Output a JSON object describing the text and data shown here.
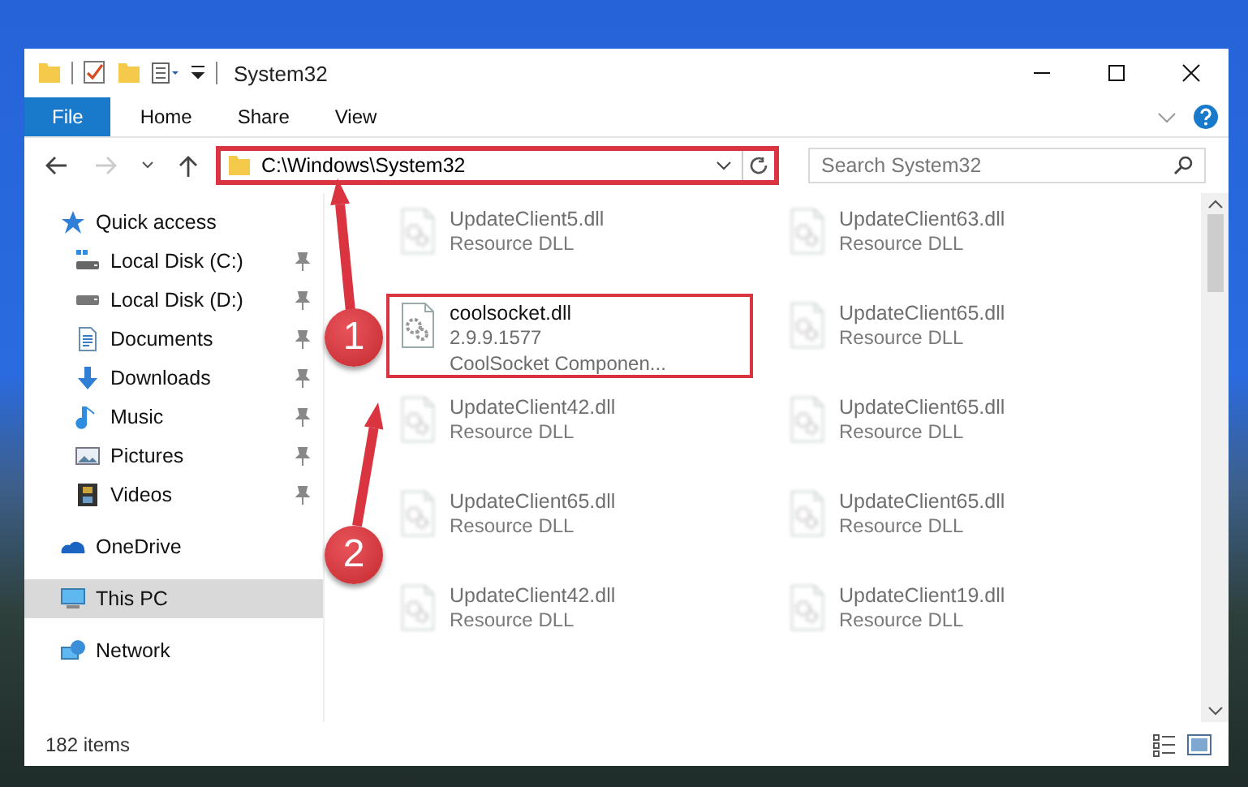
{
  "window": {
    "title": "System32"
  },
  "ribbon_tabs": [
    {
      "label": "File",
      "kind": "file"
    },
    {
      "label": "Home",
      "kind": "tab"
    },
    {
      "label": "Share",
      "kind": "tab"
    },
    {
      "label": "View",
      "kind": "tab"
    }
  ],
  "address_bar": {
    "path": "C:\\Windows\\System32",
    "highlighted": true
  },
  "search": {
    "placeholder": "Search System32"
  },
  "sidebar": {
    "items": [
      {
        "label": "Quick access",
        "kind": "star",
        "selected": false,
        "children": [
          {
            "label": "Local Disk (C:)",
            "kind": "system-drive",
            "pinned": true,
            "selected": false
          },
          {
            "label": "Local Disk (D:)",
            "kind": "drive",
            "pinned": true,
            "selected": false
          },
          {
            "label": "Documents",
            "kind": "documents",
            "pinned": true,
            "selected": false
          },
          {
            "label": "Downloads",
            "kind": "downloads",
            "pinned": true,
            "selected": false
          },
          {
            "label": "Music",
            "kind": "music",
            "pinned": true,
            "selected": false
          },
          {
            "label": "Pictures",
            "kind": "pictures",
            "pinned": true,
            "selected": false
          },
          {
            "label": "Videos",
            "kind": "videos",
            "pinned": true,
            "selected": false
          }
        ]
      },
      {
        "label": "OneDrive",
        "kind": "cloud",
        "selected": false
      },
      {
        "label": "This PC",
        "kind": "pc",
        "selected": true
      },
      {
        "label": "Network",
        "kind": "network",
        "selected": false
      }
    ]
  },
  "files": [
    {
      "name": "UpdateClient5.dll",
      "details": [
        "Resource DLL"
      ],
      "blurred": true,
      "highlighted": false
    },
    {
      "name": "UpdateClient63.dll",
      "details": [
        "Resource DLL"
      ],
      "blurred": true,
      "highlighted": false
    },
    {
      "name": "coolsocket.dll",
      "details": [
        "2.9.9.1577",
        "CoolSocket Componen..."
      ],
      "blurred": false,
      "highlighted": true
    },
    {
      "name": "UpdateClient65.dll",
      "details": [
        "Resource DLL"
      ],
      "blurred": true,
      "highlighted": false
    },
    {
      "name": "UpdateClient42.dll",
      "details": [
        "Resource DLL"
      ],
      "blurred": true,
      "highlighted": false
    },
    {
      "name": "UpdateClient65.dll",
      "details": [
        "Resource DLL"
      ],
      "blurred": true,
      "highlighted": false
    },
    {
      "name": "UpdateClient65.dll",
      "details": [
        "Resource DLL"
      ],
      "blurred": true,
      "highlighted": false
    },
    {
      "name": "UpdateClient65.dll",
      "details": [
        "Resource DLL"
      ],
      "blurred": true,
      "highlighted": false
    },
    {
      "name": "UpdateClient42.dll",
      "details": [
        "Resource DLL"
      ],
      "blurred": true,
      "highlighted": false
    },
    {
      "name": "UpdateClient19.dll",
      "details": [
        "Resource DLL"
      ],
      "blurred": true,
      "highlighted": false
    }
  ],
  "status_bar": {
    "item_count": "182 items"
  },
  "annotations": [
    {
      "number": "1"
    },
    {
      "number": "2"
    }
  ]
}
